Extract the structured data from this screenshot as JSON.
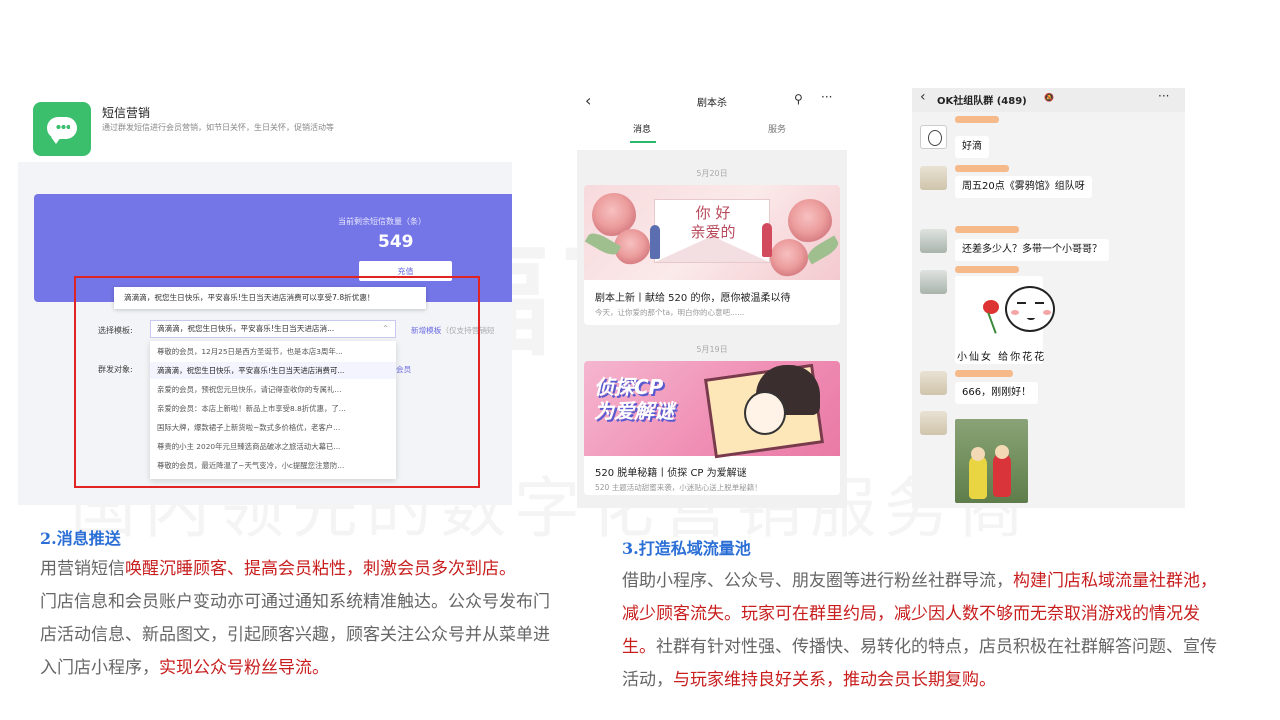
{
  "watermark": {
    "logo": "美福百联",
    "subtitle": "国内领先的数字化营销服务商"
  },
  "sms_panel": {
    "title": "短信营销",
    "description": "通过群发短信进行会员营销，如节日关怀，生日关怀，促销活动等",
    "balance_label": "当前剩余短信数量（条）",
    "balance_value": "549",
    "recharge_button": "充值",
    "tooltip": "滴滴滴，祝您生日快乐，平安喜乐!生日当天进店消费可以享受7.8折优惠！",
    "template_label": "选择模板:",
    "template_selected": "滴滴滴，祝您生日快乐，平安喜乐!生日当天进店消...",
    "new_template_link": "新增模板",
    "new_template_hint": "（仅支持营销短",
    "target_label": "群发对象:",
    "member_link": "会员",
    "template_options": [
      "尊敬的会员，12月25日是西方圣诞节，也是本店3周年...",
      "滴滴滴，祝您生日快乐，平安喜乐!生日当天进店消费可...",
      "亲爱的会员，预祝您元旦快乐，请记得查收你的专属礼...",
      "亲爱的会员：本店上新啦！新品上市享受8.8折优惠，了...",
      "国际大牌，爆款裙子上新货啦~款式多价格优，老客户...",
      "尊贵的小主 2020年元旦臻选商品破冰之旅活动大幕已...",
      "尊敬的会员，最近降温了~天气变冷，小c提醒您注意防..."
    ]
  },
  "section2": {
    "title": "2.消息推送",
    "p1_prefix": "用营销短信",
    "p1_highlight": "唤醒沉睡顾客、提高会员粘性，刺激会员多次到店。",
    "p2_prefix": "门店信息和会员账户变动亦可通过通知系统精准触达。公众号发布门店活动信息、新品图文，引起顾客兴趣，顾客关注公众号并从菜单进入门店小程序，",
    "p2_highlight": "实现公众号粉丝导流。"
  },
  "official_account": {
    "title": "剧本杀",
    "tab_messages": "消息",
    "tab_services": "服务",
    "posts": [
      {
        "date": "5月20日",
        "banner_text_1": "你 好",
        "banner_text_2": "亲爱的",
        "title": "剧本上新丨献给 520 的你，愿你被温柔以待",
        "summary": "今天，让你爱的那个ta，明白你的心意吧......"
      },
      {
        "date": "5月19日",
        "banner_text_1": "侦探CP",
        "banner_text_2": "为爱解谜",
        "title": "520 脱单秘籍丨侦探 CP 为爱解谜",
        "summary": "520 主题活动甜蜜来袭，小迷贴心送上脱单秘籍！"
      }
    ]
  },
  "group_chat": {
    "title": "OK社组队群 (489)",
    "messages": [
      "好滴",
      "周五20点《雾鸦馆》组队呀",
      "还差多少人？多带一个小哥哥？",
      "666，刚刚好！"
    ],
    "sticker_caption": "小仙女 给你花花"
  },
  "section3": {
    "title": "3.打造私域流量池",
    "s1": "借助小程序、公众号、朋友圈等进行粉丝社群导流，",
    "h1": "构建门店私域流量社群池，减少顾客流失。玩家可在群里约局，减少因人数不够而无奈取消游戏的情况发生。",
    "s2": "社群有针对性强、传播快、易转化的特点，店员积极在社群解答问题、宣传活动，",
    "h2": "与玩家维持良好关系，推动会员长期复购。"
  },
  "colors": {
    "heading_blue": "#2b6fd6",
    "highlight_red": "#c81e1e",
    "sms_green": "#3bbf6d",
    "card_purple": "#7475e6",
    "box_red": "#e02424"
  }
}
